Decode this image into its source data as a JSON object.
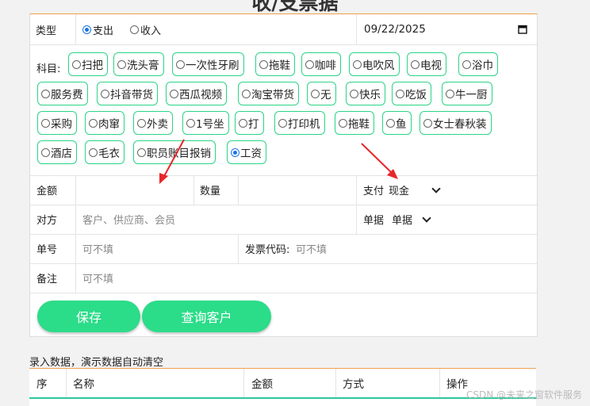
{
  "page": {
    "title": "收/支票据"
  },
  "type_row": {
    "label": "类型",
    "options": [
      {
        "label": "支出",
        "selected": true
      },
      {
        "label": "收入",
        "selected": false
      }
    ],
    "date_value": "09/22/2025",
    "date_icon": "calendar-icon"
  },
  "subject": {
    "label": "科目:",
    "items": [
      {
        "label": "扫把",
        "selected": false
      },
      {
        "label": "洗头膏",
        "selected": false
      },
      {
        "label": "一次性牙刷",
        "selected": false
      },
      {
        "label": "拖鞋",
        "selected": false
      },
      {
        "label": "咖啡",
        "selected": false
      },
      {
        "label": "电吹风",
        "selected": false
      },
      {
        "label": "电视",
        "selected": false
      },
      {
        "label": "浴巾",
        "selected": false
      },
      {
        "label": "服务费",
        "selected": false
      },
      {
        "label": "抖音带货",
        "selected": false
      },
      {
        "label": "西瓜视频",
        "selected": false
      },
      {
        "label": "淘宝带货",
        "selected": false
      },
      {
        "label": "无",
        "selected": false
      },
      {
        "label": "快乐",
        "selected": false
      },
      {
        "label": "吃饭",
        "selected": false
      },
      {
        "label": "牛一厨",
        "selected": false
      },
      {
        "label": "采购",
        "selected": false
      },
      {
        "label": "肉窜",
        "selected": false
      },
      {
        "label": "外卖",
        "selected": false
      },
      {
        "label": "1号坐",
        "selected": false
      },
      {
        "label": "打",
        "selected": false
      },
      {
        "label": "打印机",
        "selected": false
      },
      {
        "label": "拖鞋",
        "selected": false
      },
      {
        "label": "鱼",
        "selected": false
      },
      {
        "label": "女士春秋装",
        "selected": false
      },
      {
        "label": "酒店",
        "selected": false
      },
      {
        "label": "毛衣",
        "selected": false
      },
      {
        "label": "职员账目报销",
        "selected": false
      },
      {
        "label": "工资",
        "selected": true
      }
    ]
  },
  "amount_row": {
    "amount_label": "金额",
    "amount_value": "",
    "qty_label": "数量",
    "qty_value": "",
    "pay_label": "支付",
    "pay_value": "现金"
  },
  "party_row": {
    "label": "对方",
    "placeholder": "客户、供应商、会员",
    "doc_label": "单据",
    "doc_value": "单据"
  },
  "number_row": {
    "label": "单号",
    "placeholder": "可不填",
    "invoice_label": "发票代码:",
    "invoice_placeholder": "可不填"
  },
  "remark_row": {
    "label": "备注",
    "placeholder": "可不填"
  },
  "buttons": {
    "save": "保存",
    "query": "查询客户"
  },
  "list": {
    "note": "录入数据，演示数据自动清空",
    "columns": [
      "序",
      "名称",
      "金额",
      "方式",
      "操作"
    ]
  },
  "watermark": "CSDN @未来之窗软件服务",
  "colors": {
    "accent": "#2bdc89",
    "chip_border": "#2bd486",
    "arrow": "#e8262c",
    "top_border": "#f0a050"
  }
}
